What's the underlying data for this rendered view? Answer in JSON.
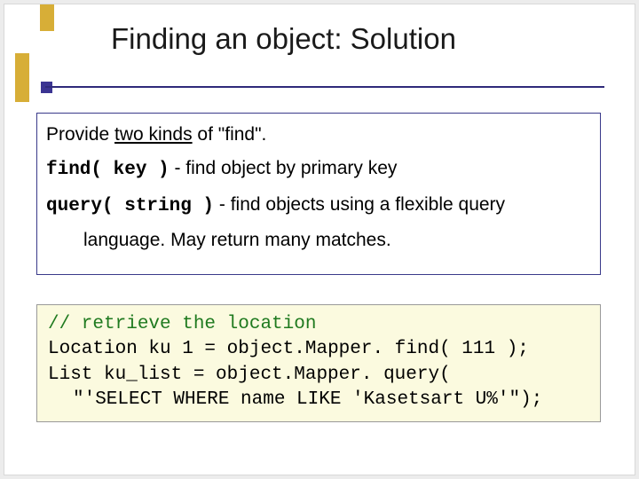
{
  "title": "Finding an object: Solution",
  "box1": {
    "intro_a": "Provide ",
    "intro_b": "two kinds",
    "intro_c": " of \"find\".",
    "find_sig": "find( key )",
    "find_desc": " - find object by primary key",
    "query_sig": "query( string )",
    "query_desc_a": " - find objects using a flexible query",
    "query_desc_b": "language.  May return many matches."
  },
  "code": {
    "c1": "// retrieve the location",
    "l2a": "Location ku",
    "l2b": " 1 = object.",
    "l2c": "Mapper.",
    "l2d": " find( 111 );",
    "l3a": "List ku_list = object.",
    "l3b": "Mapper.",
    "l3c": " query(",
    "l4": "\"'SELECT WHERE name LIKE 'Kasetsart U%'\");"
  }
}
